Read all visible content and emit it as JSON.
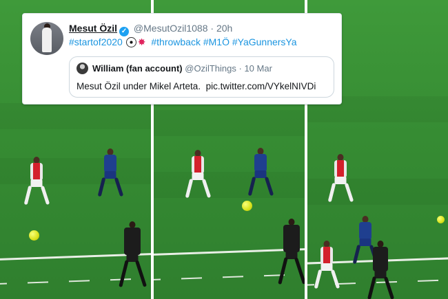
{
  "tweet": {
    "author_name": "Mesut Özil",
    "author_handle": "@MesutOzil1088",
    "separator": "·",
    "time": "20h",
    "body": {
      "hashtag_1": "#startof2020",
      "emoji_1": "soccer-ball-emoji",
      "emoji_2": "collision-emoji",
      "hashtag_2": "#throwback",
      "hashtag_3": "#M1Ö",
      "hashtag_4": "#YaGunnersYa"
    },
    "quoted": {
      "author_name": "William (fan account)",
      "author_handle": "@OzilThings",
      "separator": "·",
      "date": "10 Mar",
      "text": "Mesut Özil under Mikel Arteta.",
      "link": "pic.twitter.com/VYkelNIVDi"
    }
  },
  "colors": {
    "link_blue": "#1b95e0",
    "verified_blue": "#1da1f2",
    "pitch_green": "#368c33",
    "arsenal_red": "#d3202c",
    "chelsea_blue": "#1f3f8f",
    "ball_yellow": "#d8e21a"
  }
}
